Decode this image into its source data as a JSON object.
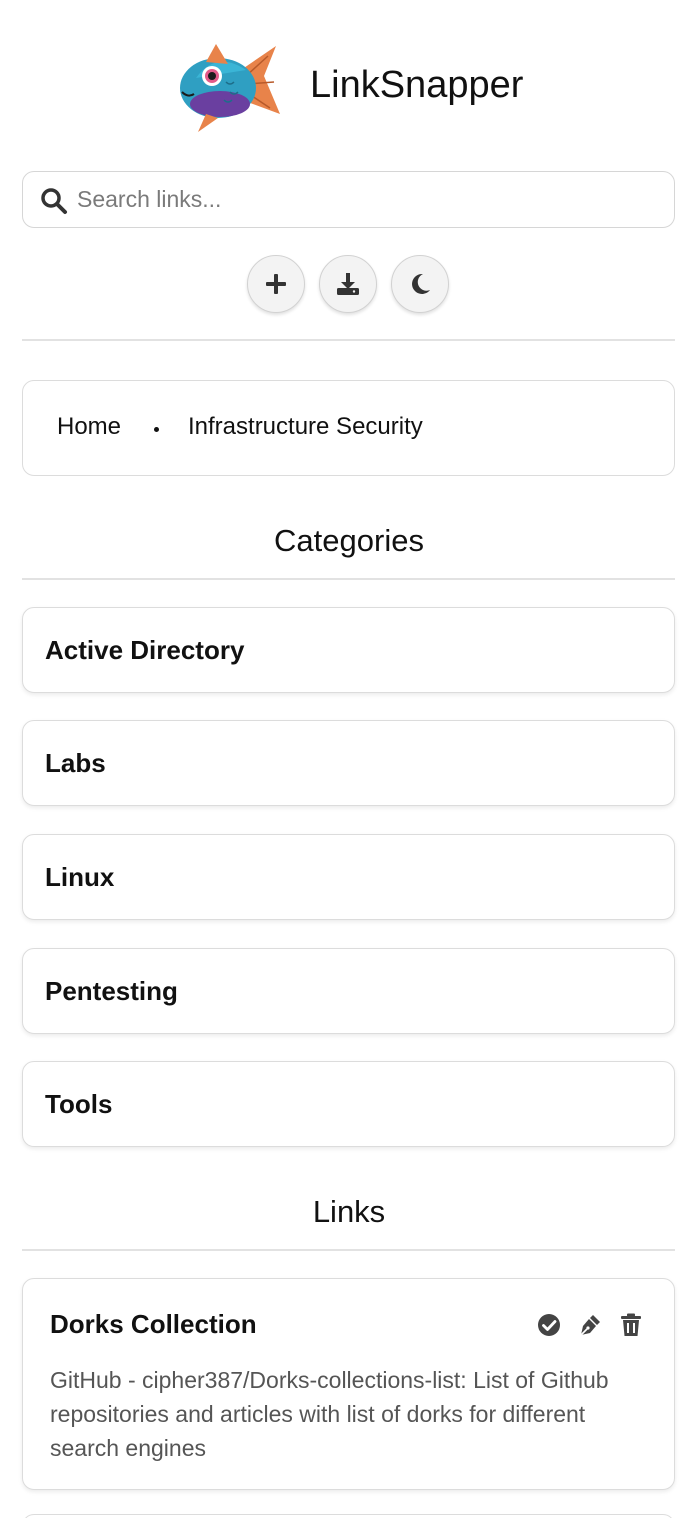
{
  "app": {
    "title": "LinkSnapper",
    "logo": "fish-logo"
  },
  "search": {
    "placeholder": "Search links...",
    "value": "",
    "icon": "search-icon"
  },
  "toolbar": [
    {
      "name": "add-button",
      "icon": "plus-icon"
    },
    {
      "name": "download-button",
      "icon": "download-icon"
    },
    {
      "name": "theme-toggle-button",
      "icon": "moon-icon"
    }
  ],
  "breadcrumb": {
    "home": "Home",
    "current": "Infrastructure Security"
  },
  "categories": {
    "heading": "Categories",
    "items": [
      "Active Directory",
      "Labs",
      "Linux",
      "Pentesting",
      "Tools"
    ]
  },
  "links": {
    "heading": "Links",
    "items": [
      {
        "title": "Dorks Collection",
        "description": "GitHub - cipher387/Dorks-collections-list: List of Github repositories and articles with list of dorks for different search engines",
        "actions": [
          "check-circle-icon",
          "pen-icon",
          "trash-icon"
        ]
      }
    ]
  },
  "colors": {
    "text": "#111111",
    "muted": "#555555",
    "border": "#dcdcdc",
    "icon": "#444444"
  }
}
